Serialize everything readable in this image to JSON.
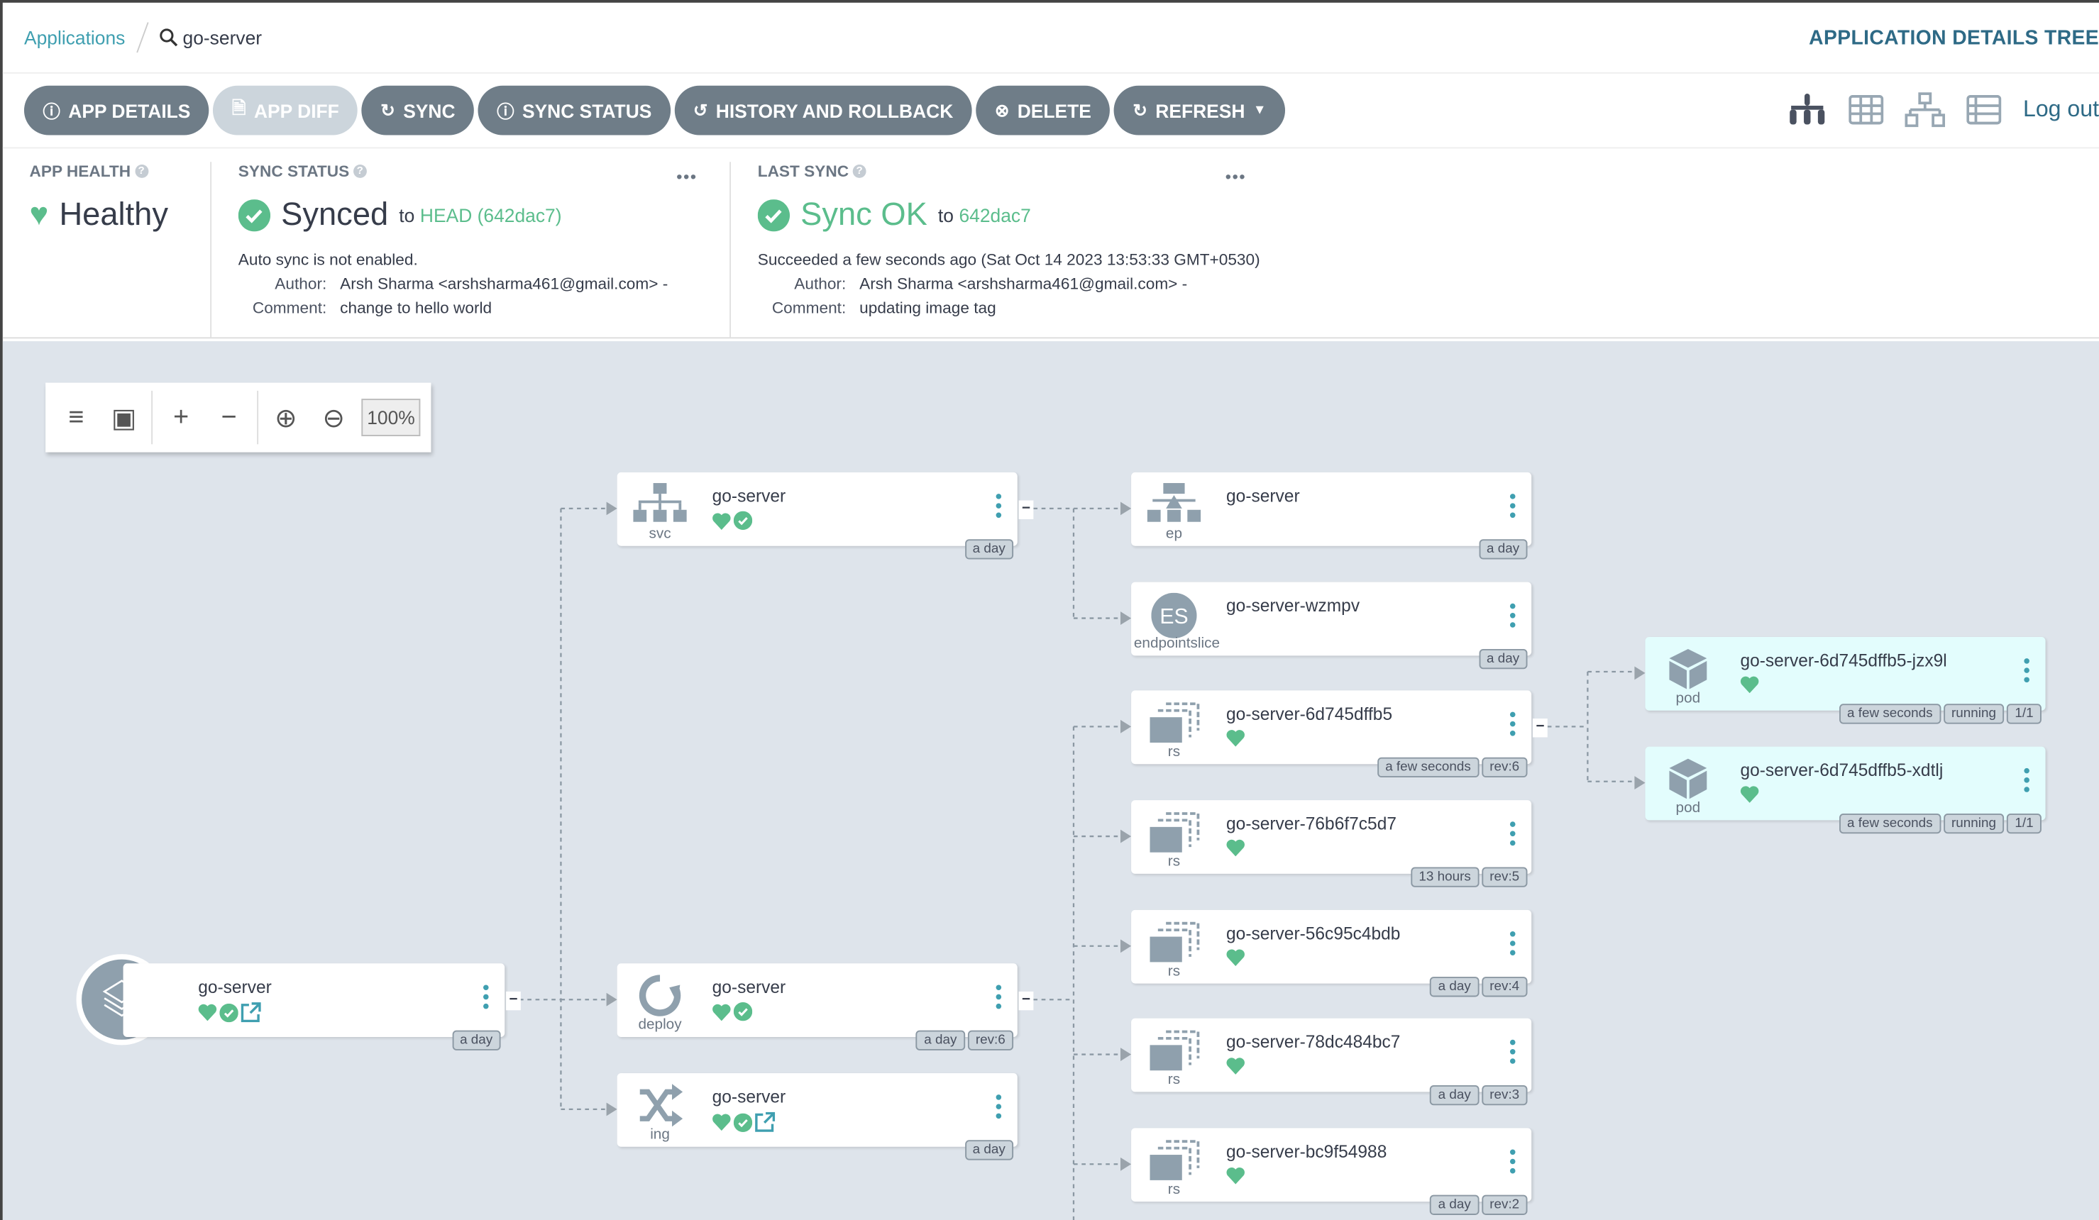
{
  "breadcrumb": {
    "applications": "Applications",
    "current": "go-server"
  },
  "page_title": "APPLICATION DETAILS TREE",
  "toolbar": {
    "buttons": [
      {
        "label": "APP DETAILS",
        "icon": "info-circle-icon"
      },
      {
        "label": "APP DIFF",
        "icon": "file-diff-icon",
        "disabled": true
      },
      {
        "label": "SYNC",
        "icon": "sync-icon"
      },
      {
        "label": "SYNC STATUS",
        "icon": "info-circle-icon"
      },
      {
        "label": "HISTORY AND ROLLBACK",
        "icon": "history-icon"
      },
      {
        "label": "DELETE",
        "icon": "times-circle-icon"
      },
      {
        "label": "REFRESH",
        "icon": "redo-icon",
        "dropdown": true
      }
    ],
    "views": [
      "tree-view-icon",
      "pods-view-icon",
      "network-view-icon",
      "list-view-icon"
    ],
    "logout": "Log out"
  },
  "summary": {
    "health": {
      "label": "APP HEALTH",
      "value": "Healthy"
    },
    "sync": {
      "label": "SYNC STATUS",
      "value": "Synced",
      "to": "to",
      "revision": "HEAD (642dac7)",
      "auto": "Auto sync is not enabled.",
      "author_label": "Author:",
      "author": "Arsh Sharma <arshsharma461@gmail.com> -",
      "comment_label": "Comment:",
      "comment": "change to hello world"
    },
    "last": {
      "label": "LAST SYNC",
      "value": "Sync OK",
      "to": "to",
      "revision": "642dac7",
      "succeeded": "Succeeded a few seconds ago (Sat Oct 14 2023 13:53:33 GMT+0530)",
      "author_label": "Author:",
      "author": "Arsh Sharma <arshsharma461@gmail.com> -",
      "comment_label": "Comment:",
      "comment": "updating image tag"
    }
  },
  "graph_tools": {
    "zoom": "100%"
  },
  "colors": {
    "healthy": "#5bbd8c",
    "accent": "#3f9fb0",
    "button": "#6f7d88",
    "canvas": "#dee4eb",
    "pod_bg": "#e3fdfd"
  },
  "nodes": [
    {
      "kind": "",
      "name": "go-server",
      "icon": "application-layers-icon",
      "health": true,
      "sync": true,
      "link": true,
      "tags": [
        "a day"
      ]
    },
    {
      "kind": "svc",
      "name": "go-server",
      "icon": "service-icon",
      "health": true,
      "sync": true,
      "tags": [
        "a day"
      ]
    },
    {
      "kind": "deploy",
      "name": "go-server",
      "icon": "deployment-icon",
      "health": true,
      "sync": true,
      "tags": [
        "a day",
        "rev:6"
      ]
    },
    {
      "kind": "ing",
      "name": "go-server",
      "icon": "ingress-icon",
      "health": true,
      "sync": true,
      "link": true,
      "tags": [
        "a day"
      ]
    },
    {
      "kind": "ep",
      "name": "go-server",
      "icon": "endpoints-icon",
      "tags": [
        "a day"
      ]
    },
    {
      "kind": "endpointslice",
      "name": "go-server-wzmpv",
      "icon": "endpointslice-icon",
      "icon_text": "ES",
      "tags": [
        "a day"
      ]
    },
    {
      "kind": "rs",
      "name": "go-server-6d745dffb5",
      "icon": "replicaset-icon",
      "health": true,
      "tags": [
        "a few seconds",
        "rev:6"
      ]
    },
    {
      "kind": "rs",
      "name": "go-server-76b6f7c5d7",
      "icon": "replicaset-icon",
      "health": true,
      "tags": [
        "13 hours",
        "rev:5"
      ]
    },
    {
      "kind": "rs",
      "name": "go-server-56c95c4bdb",
      "icon": "replicaset-icon",
      "health": true,
      "tags": [
        "a day",
        "rev:4"
      ]
    },
    {
      "kind": "rs",
      "name": "go-server-78dc484bc7",
      "icon": "replicaset-icon",
      "health": true,
      "tags": [
        "a day",
        "rev:3"
      ]
    },
    {
      "kind": "rs",
      "name": "go-server-bc9f54988",
      "icon": "replicaset-icon",
      "health": true,
      "tags": [
        "a day",
        "rev:2"
      ]
    },
    {
      "kind": "pod",
      "name": "go-server-6d745dffb5-jzx9l",
      "icon": "pod-icon",
      "health": true,
      "tags": [
        "a few seconds",
        "running",
        "1/1"
      ]
    },
    {
      "kind": "pod",
      "name": "go-server-6d745dffb5-xdtlj",
      "icon": "pod-icon",
      "health": true,
      "tags": [
        "a few seconds",
        "running",
        "1/1"
      ]
    }
  ]
}
